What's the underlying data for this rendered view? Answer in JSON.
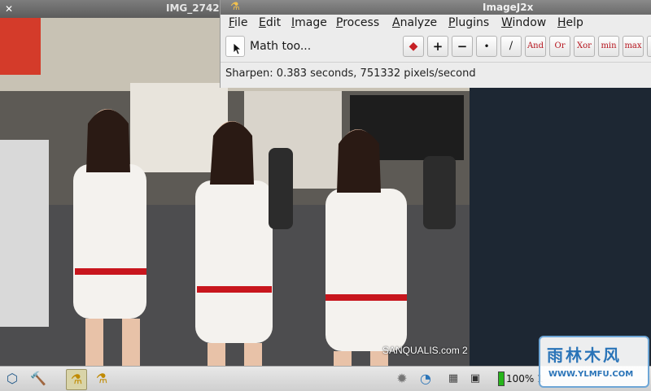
{
  "image_window": {
    "title": "IMG_2742",
    "watermark": "SANQUALIS.com 2"
  },
  "imagej": {
    "title": "ImageJ2x",
    "menus": [
      {
        "label": "File",
        "u": "F",
        "rest": "ile"
      },
      {
        "label": "Edit",
        "u": "E",
        "rest": "dit"
      },
      {
        "label": "Image",
        "u": "I",
        "rest": "mage"
      },
      {
        "label": "Process",
        "u": "P",
        "rest": "rocess"
      },
      {
        "label": "Analyze",
        "u": "A",
        "rest": "nalyze"
      },
      {
        "label": "Plugins",
        "u": "P",
        "rest": "lugins"
      },
      {
        "label": "Window",
        "u": "W",
        "rest": "indow"
      },
      {
        "label": "Help",
        "u": "H",
        "rest": "elp"
      }
    ],
    "tool_label": "Math too...",
    "op_buttons": [
      "◆",
      "+",
      "−",
      "•",
      "/",
      "And",
      "Or",
      "Xor",
      "min",
      "max"
    ],
    "status": "Sharpen: 0.383 seconds, 751332 pixels/second"
  },
  "taskbar": {
    "battery_text": "100% 1",
    "battery_level": 1.0
  },
  "watermark_badge": {
    "title": "雨林木风",
    "url": "WWW.YLMFU.COM"
  },
  "colors": {
    "desktop": "#1d2733",
    "accent_red": "#b5121b",
    "battery_green": "#27b51b"
  }
}
